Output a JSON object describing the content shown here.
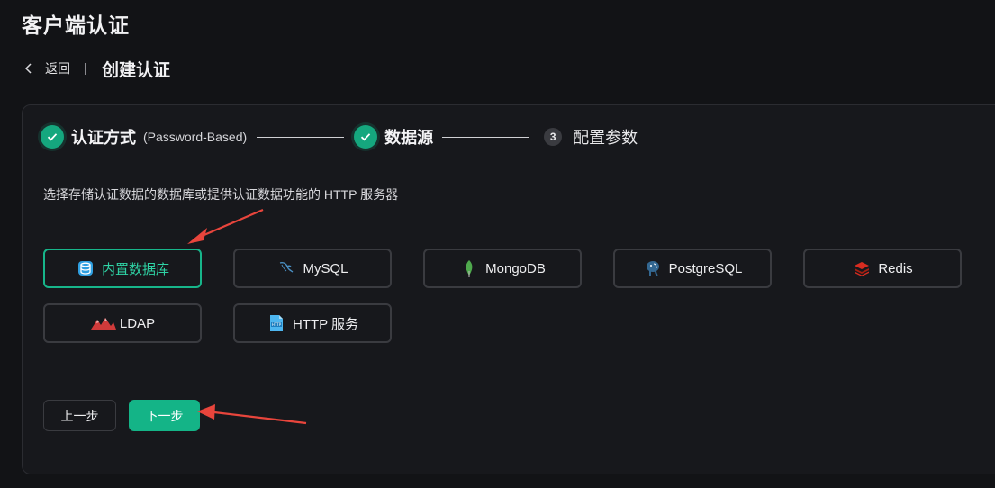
{
  "page": {
    "title": "客户端认证"
  },
  "breadcrumb": {
    "back_label": "返回",
    "current": "创建认证"
  },
  "steps": [
    {
      "status": "done",
      "title": "认证方式",
      "desc": "(Password-Based)"
    },
    {
      "status": "done",
      "title": "数据源",
      "desc": ""
    },
    {
      "status": "pending",
      "number": "3",
      "title": "配置参数",
      "desc": ""
    }
  ],
  "hint": "选择存储认证数据的数据库或提供认证数据功能的 HTTP 服务器",
  "sources": [
    {
      "label": "内置数据库",
      "icon": "database-stack-icon",
      "selected": true
    },
    {
      "label": "MySQL",
      "icon": "mysql-dolphin-icon",
      "selected": false
    },
    {
      "label": "MongoDB",
      "icon": "mongodb-leaf-icon",
      "selected": false
    },
    {
      "label": "PostgreSQL",
      "icon": "postgresql-elephant-icon",
      "selected": false
    },
    {
      "label": "Redis",
      "icon": "redis-stack-icon",
      "selected": false
    },
    {
      "label": "LDAP",
      "icon": "ldap-mountains-icon",
      "selected": false
    },
    {
      "label": "HTTP 服务",
      "icon": "http-badge-icon",
      "selected": false
    }
  ],
  "buttons": {
    "prev": "上一步",
    "next": "下一步"
  },
  "colors": {
    "accent": "#14b487",
    "selected_border": "#17b58a",
    "annotation_arrow": "#e8453c",
    "background": "#121316",
    "card": "#17181c"
  }
}
